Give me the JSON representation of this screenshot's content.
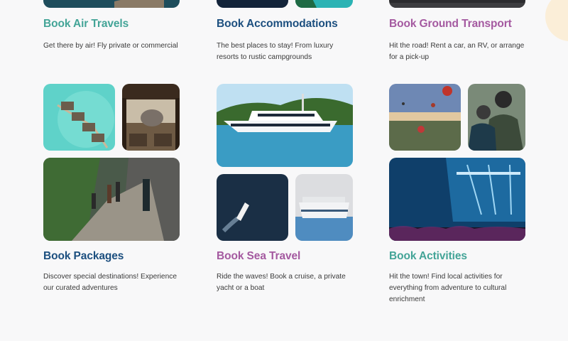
{
  "colors": {
    "teal": "#43a497",
    "navy": "#1c4f7f",
    "purple": "#a459a0",
    "text": "#3a3a3a",
    "background": "#f8f8f9",
    "accent_circle": "#fbeed8"
  },
  "cards": [
    {
      "title": "Book Air Travels",
      "description": "Get there by air! Fly private or commercial",
      "color": "#43a497"
    },
    {
      "title": "Book Accommodations",
      "description": "The best places to stay! From luxury resorts to rustic campgrounds",
      "color": "#1c4f7f"
    },
    {
      "title": "Book Ground Transport",
      "description": "Hit the road! Rent a car, an RV, or arrange for a pick-up",
      "color": "#a459a0"
    },
    {
      "title": "Book Packages",
      "description": "Discover special destinations! Experience our curated adventures",
      "color": "#1c4f7f",
      "images": [
        "overwater-bungalows-photo",
        "safari-elephant-photo",
        "mountain-hikers-photo"
      ]
    },
    {
      "title": "Book Sea Travel",
      "description": "Ride the waves! Book a cruise, a private yacht or a boat",
      "color": "#a459a0",
      "images": [
        "luxury-yacht-photo",
        "speedboat-aerial-photo",
        "cruise-ship-photo"
      ]
    },
    {
      "title": "Book Activities",
      "description": "Hit the town! Find local activities for everything from adventure to cultural enrichment",
      "color": "#43a497",
      "images": [
        "hot-air-balloons-photo",
        "tourists-sightseeing-photo",
        "concert-crowd-photo"
      ]
    }
  ]
}
